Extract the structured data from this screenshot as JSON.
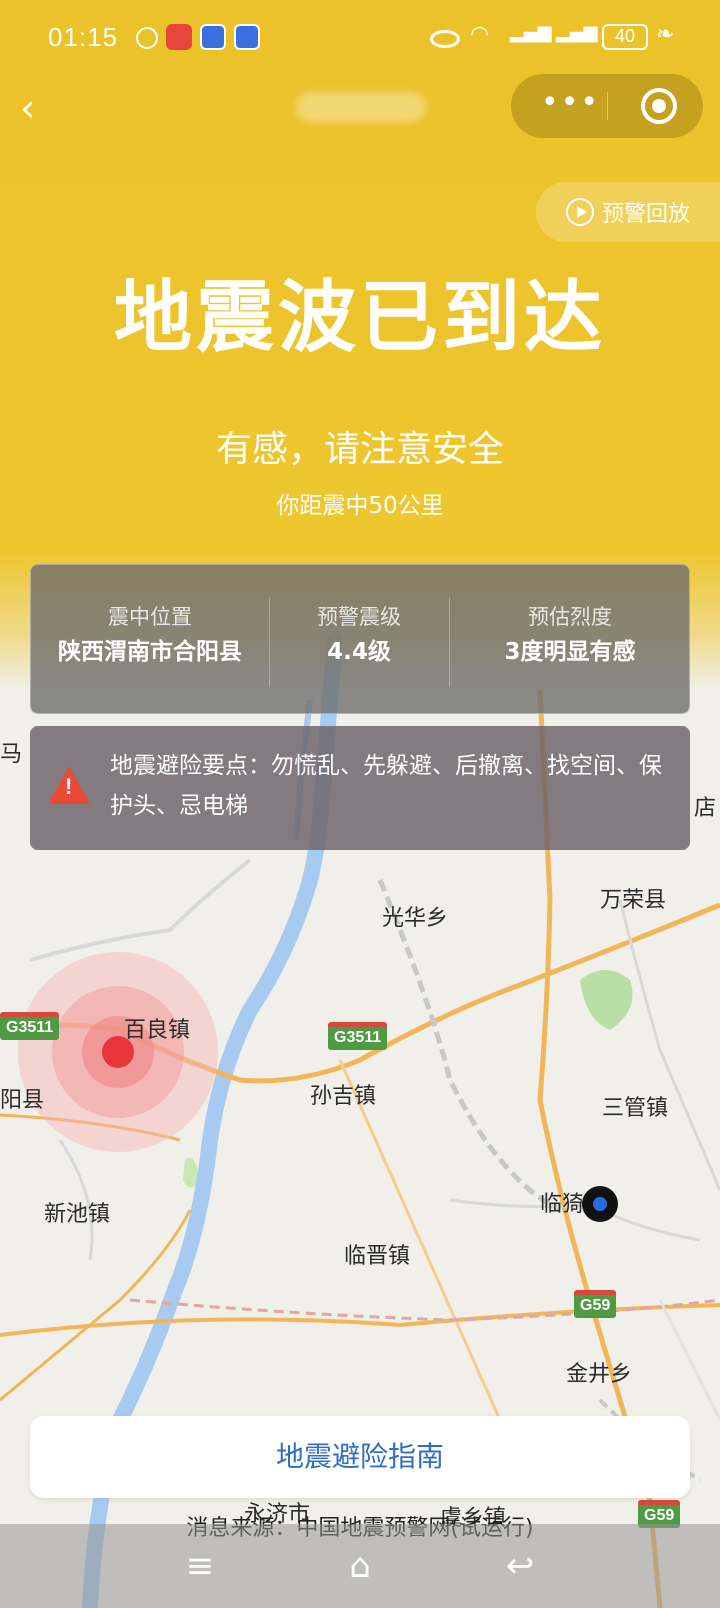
{
  "status_bar": {
    "time": "01:15",
    "battery": "40"
  },
  "header": {
    "replay_label": "预警回放"
  },
  "hero": {
    "title": "地震波已到达",
    "subtitle": "有感，请注意安全",
    "distance": "你距震中50公里"
  },
  "info": {
    "epicenter_label": "震中位置",
    "epicenter_value": "陕西渭南市合阳县",
    "magnitude_label": "预警震级",
    "magnitude_value": "4.4级",
    "intensity_label": "预估烈度",
    "intensity_value": "3度明显有感"
  },
  "tip": {
    "text": "地震避险要点：勿慌乱、先躲避、后撤离、找空间、保护头、忌电梯"
  },
  "map": {
    "labels": {
      "guanghua": "光华乡",
      "wanrong": "万荣县",
      "bailiang": "百良镇",
      "sunji": "孙吉镇",
      "sanguan": "三管镇",
      "xinchi": "新池镇",
      "linjin": "临晋镇",
      "linyi": "临猗",
      "jinjing": "金井乡",
      "yongji": "永济市",
      "yuxiang": "虞乡镇",
      "yang": "阳县",
      "ma": "马",
      "dian": "店"
    },
    "highways": {
      "g3511": "G3511",
      "g59": "G59"
    },
    "colors": {
      "water": "#a7cbf0",
      "road": "#f2b65a",
      "epicenter": "#e8363a",
      "user": "#2a6ae0"
    }
  },
  "guide_button": "地震避险指南",
  "source": "消息来源：中国地震预警网(试运行)"
}
